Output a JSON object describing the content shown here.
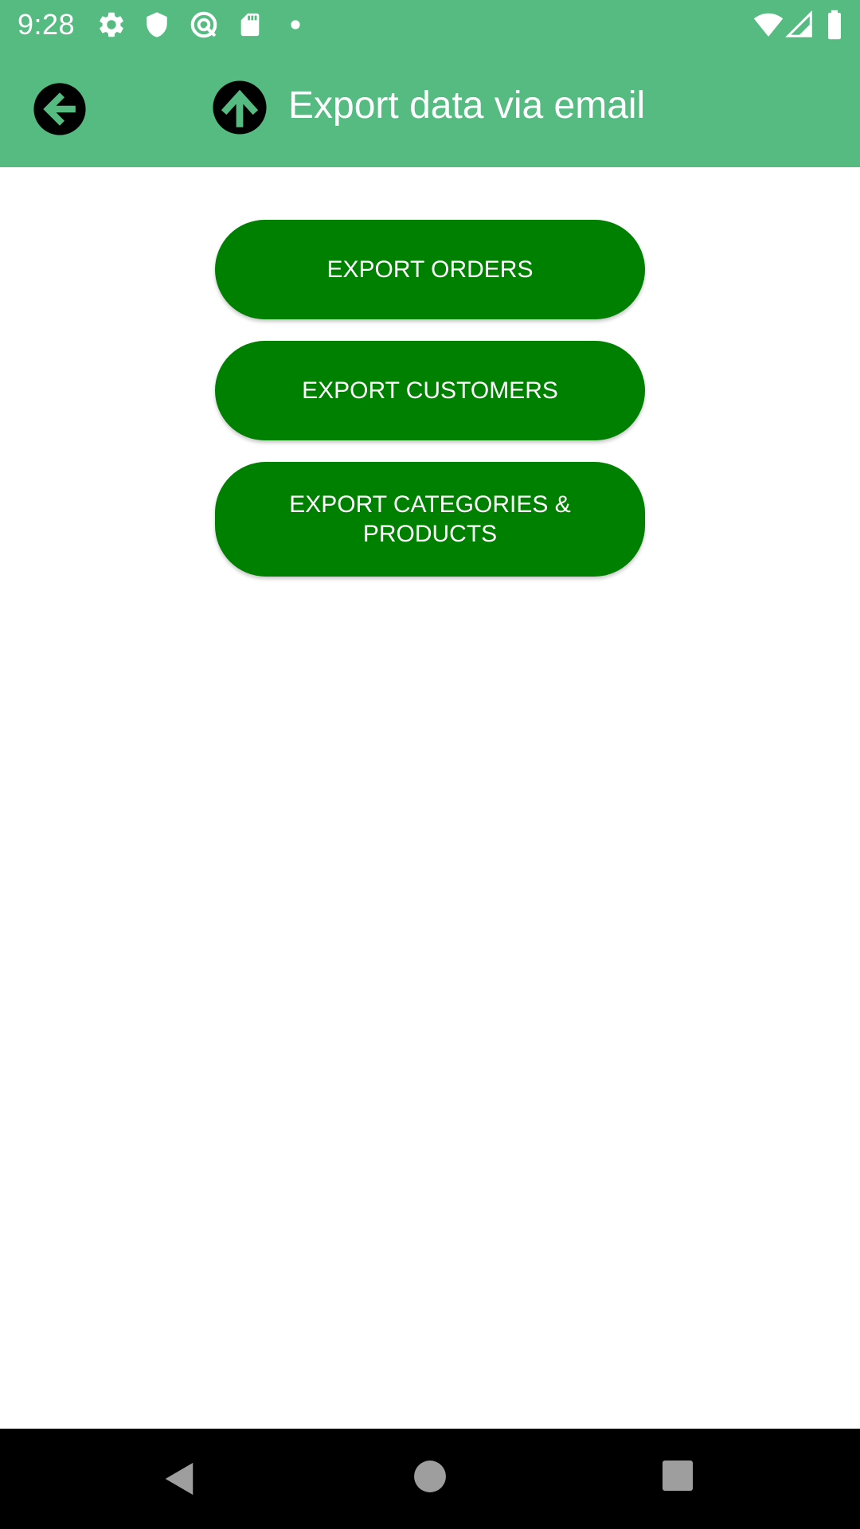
{
  "status_bar": {
    "time": "9:28",
    "left_icons": [
      "gear-icon",
      "shield-icon",
      "sync-icon",
      "sd-card-icon",
      "dot-icon"
    ],
    "right_icons": [
      "wifi-icon",
      "signal-icon",
      "battery-icon"
    ],
    "background": "#55bb80"
  },
  "app_bar": {
    "title": "Export data via email",
    "back_icon": "arrow-left-circle-icon",
    "title_icon": "arrow-up-circle-icon",
    "background": "#55bb80"
  },
  "actions": [
    {
      "label": "EXPORT ORDERS"
    },
    {
      "label": "EXPORT CUSTOMERS"
    },
    {
      "label": "EXPORT CATEGORIES & PRODUCTS"
    }
  ],
  "button_color": "#008000",
  "nav_bar": {
    "items": [
      "back-triangle-icon",
      "home-circle-icon",
      "recents-square-icon"
    ]
  }
}
